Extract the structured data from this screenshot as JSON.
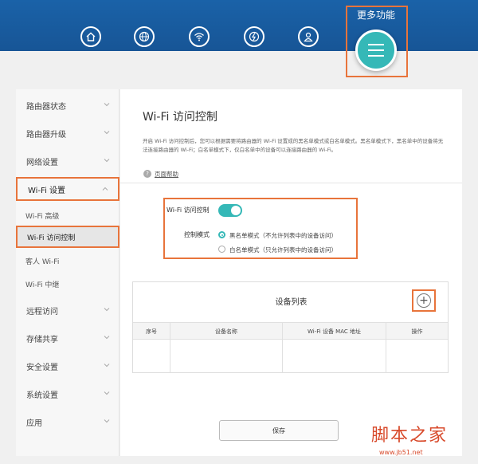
{
  "header": {
    "nav_icons": [
      "home-icon",
      "globe-icon",
      "wifi-icon",
      "network-icon",
      "user-icon"
    ],
    "more_label": "更多功能",
    "menu_icon": "hamburger-icon"
  },
  "sidebar": {
    "items": [
      {
        "label": "路由器状态"
      },
      {
        "label": "路由器升级"
      },
      {
        "label": "网络设置"
      },
      {
        "label": "Wi-Fi 设置"
      },
      {
        "label": "Wi-Fi 高级"
      },
      {
        "label": "Wi-Fi 访问控制"
      },
      {
        "label": "客人 Wi-Fi"
      },
      {
        "label": "Wi-Fi 中继"
      },
      {
        "label": "远程访问"
      },
      {
        "label": "存储共享"
      },
      {
        "label": "安全设置"
      },
      {
        "label": "系统设置"
      },
      {
        "label": "应用"
      }
    ]
  },
  "main": {
    "title": "Wi-Fi 访问控制",
    "description": "开启 Wi-Fi 访问控制后，您可以根据需要将路由器的 Wi-Fi 设置成的黑名单模式或白名单模式。黑名单模式下，黑名单中的设备将无法连接路由器的 Wi-Fi；白名单模式下，仅白名单中的设备可以连接路由器的 Wi-Fi。",
    "help_icon": "?",
    "help_link": "页面帮助",
    "access_control_label": "Wi-Fi 访问控制",
    "access_control_on": true,
    "mode_label": "控制模式",
    "mode_blacklist": "黑名单模式（不允许列表中的设备访问）",
    "mode_whitelist": "白名单模式（只允许列表中的设备访问）",
    "selected_mode": "blacklist",
    "device_list_title": "设备列表",
    "add_label": "+",
    "columns": [
      "序号",
      "设备名称",
      "Wi-Fi 设备 MAC 地址",
      "操作"
    ],
    "save_label": "保存"
  },
  "watermark": {
    "big": "脚本之家",
    "small": "www.jb51.net"
  },
  "colors": {
    "header_blue": "#1a62a8",
    "accent_teal": "#35b8b7",
    "highlight_orange": "#e8743b"
  }
}
